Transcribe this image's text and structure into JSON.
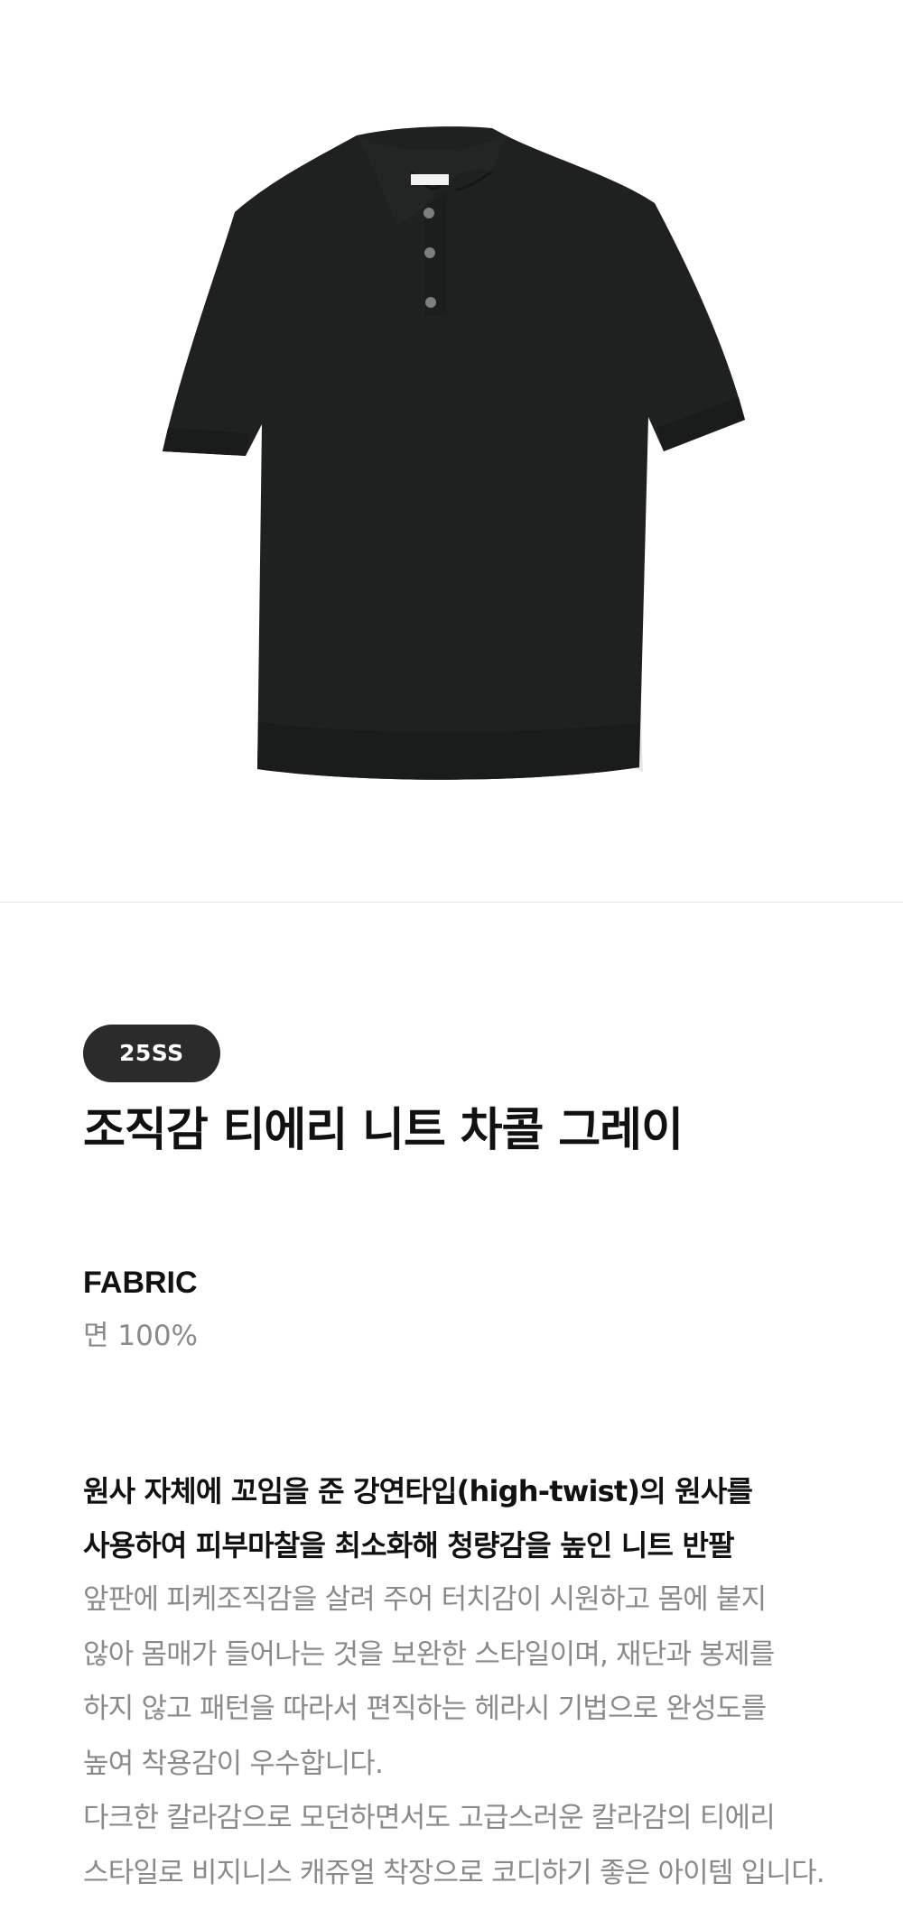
{
  "product": {
    "season": "25SS",
    "title": "조직감 티에리 니트 차콜 그레이",
    "image_alt": "charcoal knit polo shirt"
  },
  "fabric": {
    "heading": "FABRIC",
    "value": "면 100%"
  },
  "description": {
    "headline_lines": [
      "원사 자체에 꼬임을 준 강연타입(high-twist)의 원사를",
      "사용하여 피부마찰을 최소화해 청량감을 높인 니트 반팔"
    ],
    "body_lines": [
      "앞판에 피케조직감을 살려 주어 터치감이 시원하고 몸에 붙지",
      "않아 몸매가 들어나는 것을 보완한 스타일이며, 재단과 봉제를",
      "하지 않고 패턴을 따라서 편직하는 헤라시 기법으로 완성도를",
      "높여 착용감이 우수합니다.",
      "다크한 칼라감으로 모던하면서도 고급스러운 칼라감의 티에리",
      "스타일로 비지니스 캐쥬얼 착장으로 코디하기 좋은 아이템 입니다."
    ]
  },
  "colors": {
    "garment": "#1f2121",
    "badge_bg": "#2b2b2b",
    "muted_text": "#8a8a8a"
  }
}
